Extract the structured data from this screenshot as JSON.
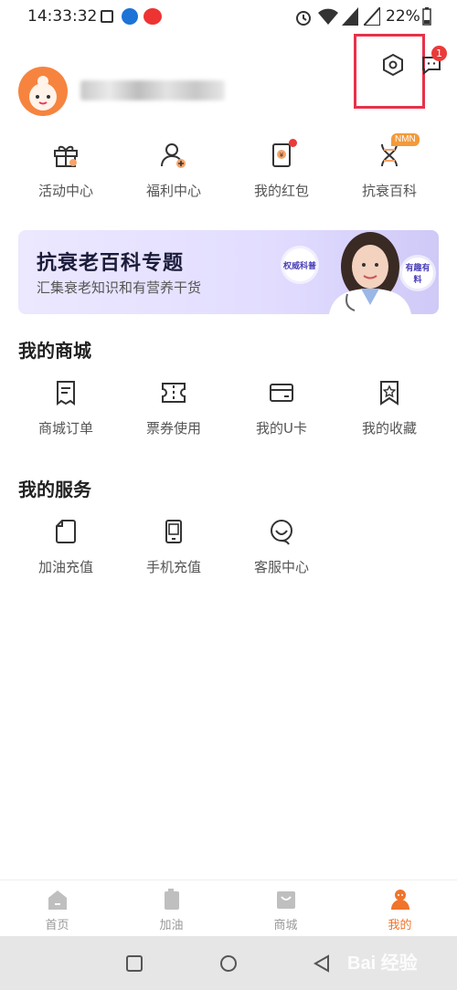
{
  "status_bar": {
    "time": "14:33:32",
    "battery": "22%"
  },
  "header": {
    "username_blurred": true,
    "message_badge": "1"
  },
  "quick_actions": [
    {
      "label": "活动中心",
      "icon": "gift-icon"
    },
    {
      "label": "福利中心",
      "icon": "user-plus-icon"
    },
    {
      "label": "我的红包",
      "icon": "red-packet-icon"
    },
    {
      "label": "抗衰百科",
      "icon": "dna-icon",
      "tag": "NMN"
    }
  ],
  "banner": {
    "title": "抗衰老百科专题",
    "subtitle": "汇集衰老知识和有营养干货",
    "bubble_left": "权威科普",
    "bubble_right": "有趣有料"
  },
  "mall": {
    "title": "我的商城",
    "items": [
      {
        "label": "商城订单",
        "icon": "order-icon"
      },
      {
        "label": "票券使用",
        "icon": "ticket-icon"
      },
      {
        "label": "我的U卡",
        "icon": "card-icon"
      },
      {
        "label": "我的收藏",
        "icon": "bookmark-star-icon"
      }
    ]
  },
  "services": {
    "title": "我的服务",
    "items": [
      {
        "label": "加油充值",
        "icon": "fuel-card-icon"
      },
      {
        "label": "手机充值",
        "icon": "phone-icon"
      },
      {
        "label": "客服中心",
        "icon": "headset-icon"
      }
    ]
  },
  "bottom_nav": [
    {
      "label": "首页",
      "icon": "home-icon",
      "active": false
    },
    {
      "label": "加油",
      "icon": "fuel-icon",
      "active": false
    },
    {
      "label": "商城",
      "icon": "shop-icon",
      "active": false
    },
    {
      "label": "我的",
      "icon": "profile-icon",
      "active": true
    }
  ],
  "watermark": "Bai 经验",
  "colors": {
    "accent": "#f0742b",
    "highlight": "#e8314a",
    "badge": "#ea3a3a",
    "banner_bg": "#e2ddff"
  }
}
